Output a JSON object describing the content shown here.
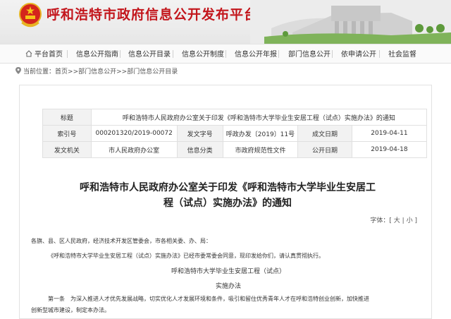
{
  "site": {
    "title": "呼和浩特市政府信息公开发布平台"
  },
  "nav": [
    {
      "label": "平台首页",
      "icon": "home-icon"
    },
    {
      "label": "信息公开指南"
    },
    {
      "label": "信息公开目录"
    },
    {
      "label": "信息公开制度"
    },
    {
      "label": "信息公开年报"
    },
    {
      "label": "部门信息公开"
    },
    {
      "label": "依申请公开"
    },
    {
      "label": "社会监督"
    }
  ],
  "breadcrumb": {
    "prefix": "当前位置：",
    "items": [
      "首页",
      "部门信息公开",
      "部门信息公开目录"
    ],
    "sep": ">>"
  },
  "meta": {
    "title_label": "标题",
    "title_value": "呼和浩特市人民政府办公室关于印发《呼和浩特市大学毕业生安居工程（试点）实施办法》的通知",
    "index_label": "索引号",
    "index_value": "000201320/2019-00072",
    "docno_label": "发文字号",
    "docno_value": "呼政办发〔2019〕11号",
    "created_label": "成文日期",
    "created_value": "2019-04-11",
    "issuer_label": "发文机关",
    "issuer_value": "市人民政府办公室",
    "category_label": "信息分类",
    "category_value": "市政府规范性文件",
    "publish_label": "公开日期",
    "publish_value": "2019-04-18"
  },
  "doc": {
    "title_line1": "呼和浩特市人民政府办公室关于印发《呼和浩特市大学毕业生安居工",
    "title_line2": "程（试点）实施办法》的通知"
  },
  "fontsize": {
    "label": "字体：[",
    "large": "大",
    "sep": "|",
    "small": "小",
    "close": "]"
  },
  "body": {
    "greeting": "各旗、县、区人民政府，经济技术开发区管委会，市各相关委、办、局：",
    "para1": "《呼和浩特市大学毕业生安居工程（试点）实施办法》已经市委常委会同意，现印发给你们，请认真贯彻执行。",
    "sub_title": "呼和浩特市大学毕业生安居工程（试点）",
    "sub_title2": "实施办法",
    "article1": "第一条　为深入推进人才优先发展战略，切实优化人才发展环境和条件，吸引和留住优秀青年人才在呼和浩特创业创新，加快推进",
    "article1_cont": "创新型城市建设，制定本办法。"
  },
  "colors": {
    "brand_red": "#c3161c"
  }
}
